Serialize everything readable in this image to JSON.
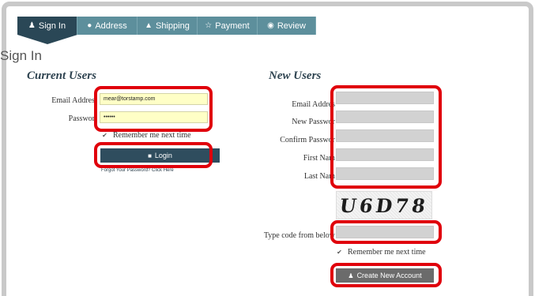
{
  "tabs": [
    {
      "label": "Sign In",
      "icon": "user-icon",
      "glyph": "♟"
    },
    {
      "label": "Address",
      "icon": "map-pin-icon",
      "glyph": "●"
    },
    {
      "label": "Shipping",
      "icon": "truck-icon",
      "glyph": "▲"
    },
    {
      "label": "Payment",
      "icon": "star-icon",
      "glyph": "☆"
    },
    {
      "label": "Review",
      "icon": "eye-icon",
      "glyph": "◉"
    }
  ],
  "page_title": "Sign In",
  "current_users": {
    "title": "Current Users",
    "email_label": "Email Addres",
    "email_value": "mear@torstamp.com",
    "password_label": "Passwor",
    "password_value": "••••••",
    "remember_label": "Remember me next time",
    "login_label": "Login",
    "forgot_label": "Forgot Your Password? Click Here"
  },
  "new_users": {
    "title": "New Users",
    "email_label": "Email Addres",
    "new_password_label": "New Passwor",
    "confirm_password_label": "Confirm Passwor",
    "first_name_label": "First Nam",
    "last_name_label": "Last Nam",
    "captcha_text": "U6D78",
    "code_label": "Type code from below",
    "remember_label": "Remember me next time",
    "create_label": "Create New Account"
  },
  "colors": {
    "tab_active": "#2a4756",
    "tab_inactive": "#5d8f9c",
    "highlight": "#e0000b",
    "input_yellow": "#ffffc6",
    "input_gray": "#d2d2d2"
  }
}
